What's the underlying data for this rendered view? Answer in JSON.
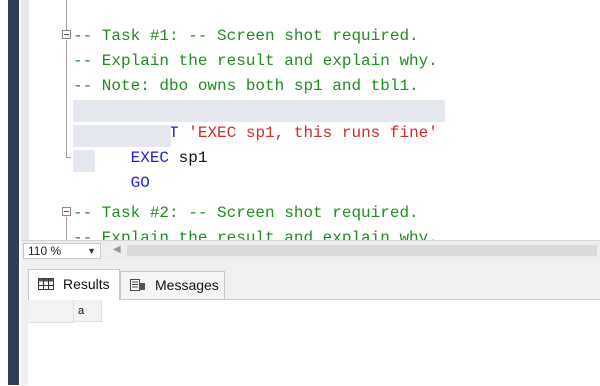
{
  "editor": {
    "lines": [
      {
        "text": "-- Task #1: -- Screen shot required.",
        "kind": "comment"
      },
      {
        "text": "-- Explain the result and explain why.",
        "kind": "comment"
      },
      {
        "text": "-- Note: dbo owns both sp1 and tbl1.",
        "kind": "comment"
      },
      {
        "kw": "PRINT",
        "str": "'EXEC sp1, this runs fine'",
        "kind": "print"
      },
      {
        "kw": "EXEC",
        "plain": " sp1",
        "kind": "exec"
      },
      {
        "kw": "GO",
        "kind": "go"
      },
      {
        "text": "-- Task #2: -- Screen shot required.",
        "kind": "comment"
      },
      {
        "text": "-- Explain the result and explain why.",
        "kind": "comment"
      }
    ]
  },
  "zoom": {
    "value": "110 %"
  },
  "results": {
    "tabs": [
      {
        "label": "Results",
        "active": true
      },
      {
        "label": "Messages",
        "active": false
      }
    ],
    "columns": [
      "a"
    ]
  },
  "colors": {
    "keyword": "#1f1fd6",
    "string": "#d12b2b",
    "comment": "#228b22",
    "left_rail": "#2d3e5c"
  }
}
